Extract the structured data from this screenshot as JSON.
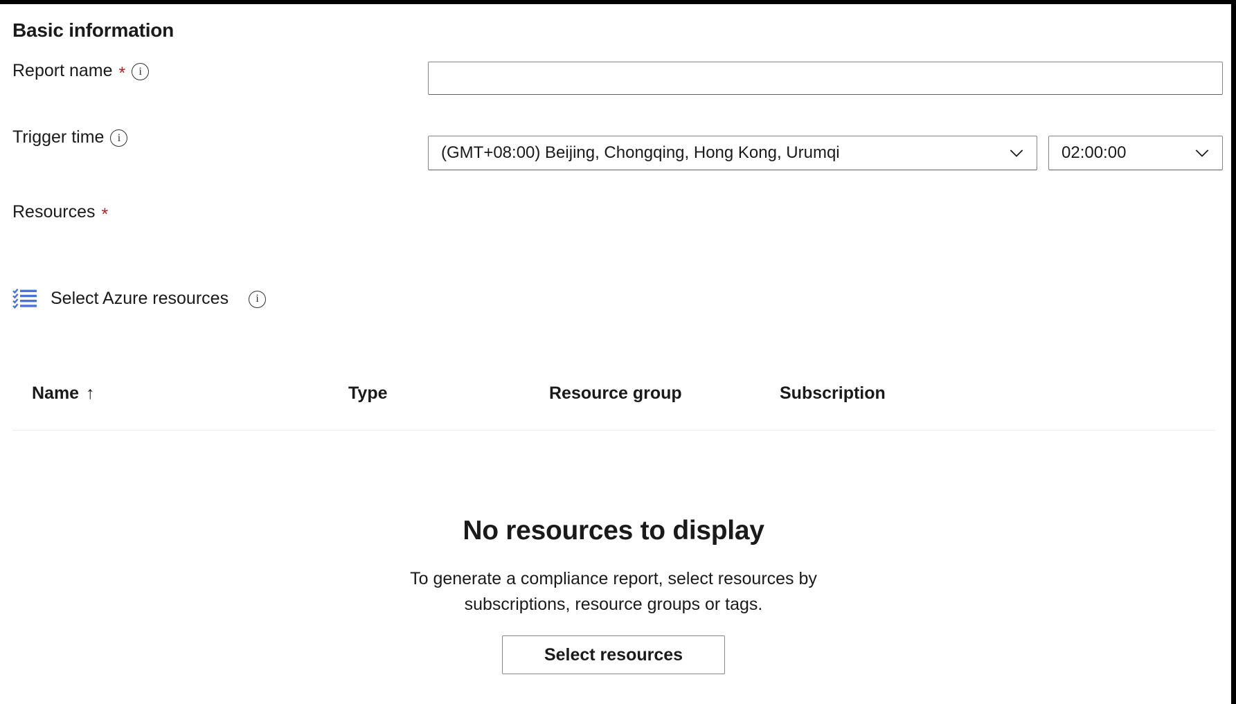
{
  "section": {
    "title": "Basic information"
  },
  "fields": {
    "report_name": {
      "label": "Report name",
      "required_marker": "*",
      "info_icon": "info-icon",
      "value": "",
      "placeholder": ""
    },
    "trigger_time": {
      "label": "Trigger time",
      "info_icon": "info-icon",
      "timezone_value": "(GMT+08:00) Beijing, Chongqing, Hong Kong, Urumqi",
      "time_value": "02:00:00",
      "chevron_icon": "chevron-down-icon"
    },
    "resources": {
      "label": "Resources",
      "required_marker": "*"
    }
  },
  "azure_resources": {
    "icon": "checklist-icon",
    "label": "Select Azure resources",
    "info_icon": "info-icon"
  },
  "table": {
    "columns": [
      {
        "label": "Name",
        "sort_indicator": "↑"
      },
      {
        "label": "Type",
        "sort_indicator": ""
      },
      {
        "label": "Resource group",
        "sort_indicator": ""
      },
      {
        "label": "Subscription",
        "sort_indicator": ""
      }
    ],
    "rows": []
  },
  "empty_state": {
    "title": "No resources to display",
    "description": "To generate a compliance report, select resources by subscriptions, resource groups or tags.",
    "button_label": "Select resources"
  },
  "colors": {
    "required_asterisk": "#a4262c",
    "accent_blue": "#4a74d4",
    "text": "#1b1a19",
    "border": "#8a8886",
    "divider": "#edebe9"
  }
}
